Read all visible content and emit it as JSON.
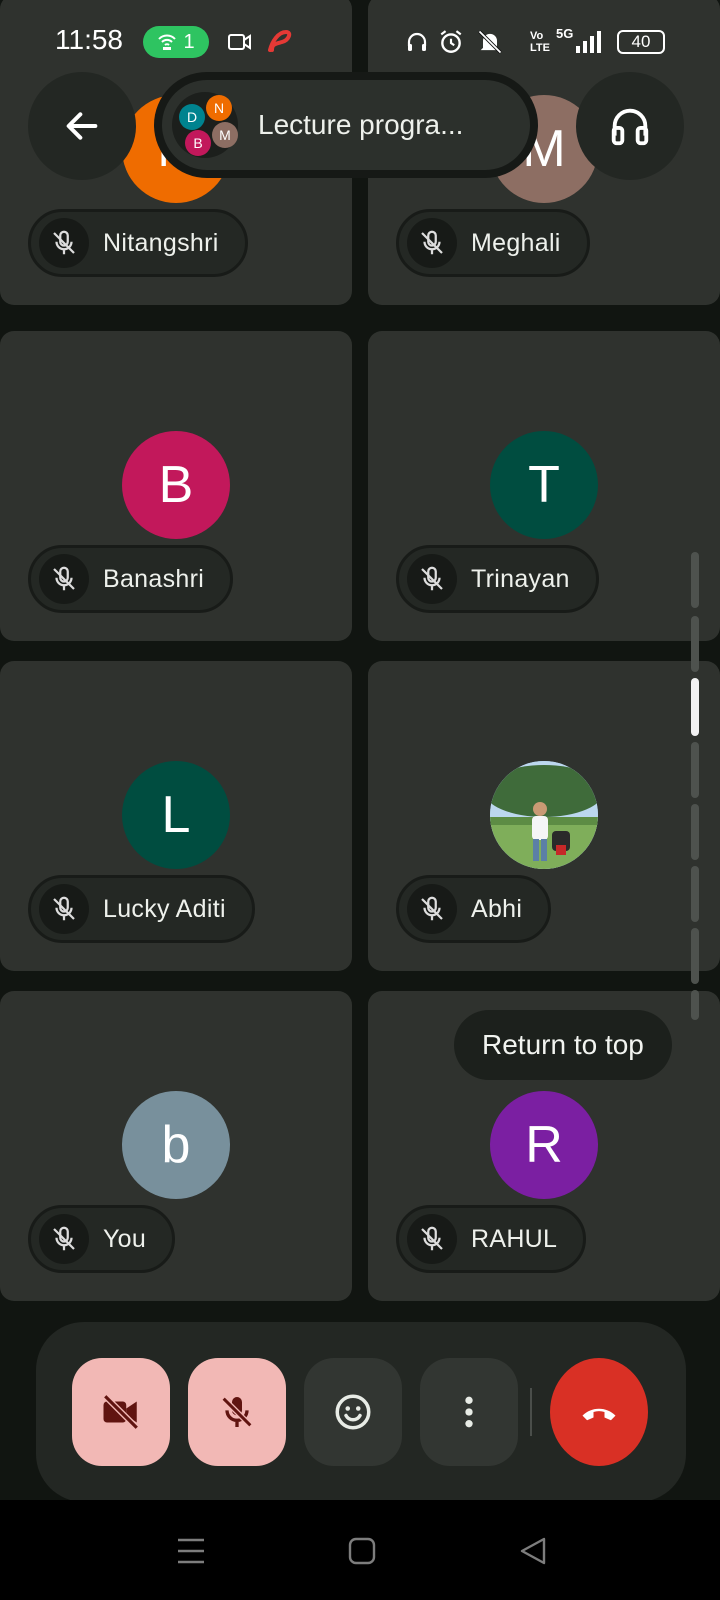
{
  "status_bar": {
    "time": "11:58",
    "hotspot_count": "1",
    "network": "5G",
    "volte": "Vo LTE",
    "battery": "40"
  },
  "header": {
    "meeting_title": "Lecture progra...",
    "participant_initials": [
      "D",
      "N",
      "B",
      "M"
    ],
    "back_icon": "arrow-left-icon",
    "audio_icon": "headphones-icon"
  },
  "participants": [
    {
      "name": "Nitangshri",
      "initial": "N",
      "color": "#ef6c00"
    },
    {
      "name": "Meghali",
      "initial": "M",
      "color": "#8d6e63"
    },
    {
      "name": "Banashri",
      "initial": "B",
      "color": "#c2185b"
    },
    {
      "name": "Trinayan",
      "initial": "T",
      "color": "#004d40"
    },
    {
      "name": "Lucky Aditi",
      "initial": "L",
      "color": "#004d40"
    },
    {
      "name": "Abhi",
      "initial": "",
      "color": "#6aa56a"
    },
    {
      "name": "You",
      "initial": "b",
      "color": "#78909c"
    },
    {
      "name": "RAHUL",
      "initial": "R",
      "color": "#7b1fa2"
    }
  ],
  "tooltip": {
    "label": "Return to top"
  },
  "controls": {
    "camera_icon": "camera-off-icon",
    "mic_icon": "mic-off-icon",
    "reactions_icon": "emoji-icon",
    "more_icon": "more-vert-icon",
    "end_call_icon": "call-end-icon",
    "danger_color": "#d93025",
    "off_bg_color": "#f2b8b5"
  }
}
